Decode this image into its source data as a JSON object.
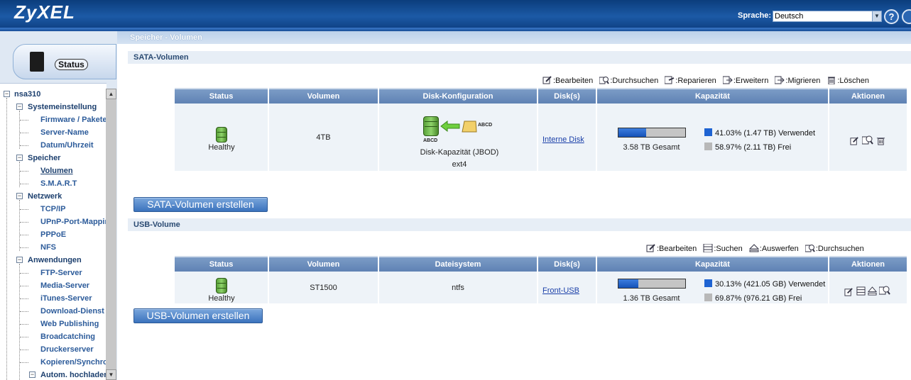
{
  "header": {
    "logo": "ZyXEL",
    "lang_label": "Sprache:",
    "lang_value": "Deutsch",
    "help_label": "?"
  },
  "sidebar": {
    "status_label": "Status",
    "tree": {
      "root": "nsa310",
      "systemeinstellung": "Systemeinstellung",
      "firmware": "Firmware / Pakete",
      "servername": "Server-Name",
      "datum": "Datum/Uhrzeit",
      "speicher": "Speicher",
      "volumen": "Volumen",
      "smart": "S.M.A.R.T",
      "netzwerk": "Netzwerk",
      "tcpip": "TCP/IP",
      "upnp": "UPnP-Port-Mapping",
      "pppoe": "PPPoE",
      "nfs": "NFS",
      "anwendungen": "Anwendungen",
      "ftp": "FTP-Server",
      "media": "Media-Server",
      "itunes": "iTunes-Server",
      "download": "Download-Dienst",
      "webpub": "Web Publishing",
      "broadcast": "Broadcatching",
      "drucker": "Druckerserver",
      "kopieren": "Kopieren/Synchronisieren",
      "autom": "Autom. hochladen"
    }
  },
  "main": {
    "breadcrumb": "Speicher - Volumen",
    "sata": {
      "title": "SATA-Volumen",
      "toolbar": {
        "edit": ":Bearbeiten",
        "search": ":Durchsuchen",
        "repair": ":Reparieren",
        "expand": ":Erweitern",
        "migrate": ":Migrieren",
        "delete": ":Löschen"
      },
      "columns": [
        "Status",
        "Volumen",
        "Disk-Konfiguration",
        "Disk(s)",
        "Kapazität",
        "Aktionen"
      ],
      "row": {
        "status": "Healthy",
        "volume": "4TB",
        "disk_label_a": "ABCD",
        "disk_label_b": "ABCD",
        "config": "Disk-Kapazität (JBOD)",
        "fs": "ext4",
        "disks": "Interne Disk",
        "total": "3.58 TB Gesamt",
        "used_pct": 41.03,
        "used": "41.03% (1.47 TB) Verwendet",
        "free": "58.97% (2.11 TB) Frei"
      },
      "create_button": "SATA-Volumen erstellen"
    },
    "usb": {
      "title": "USB-Volume",
      "toolbar": {
        "edit": ":Bearbeiten",
        "search": ":Suchen",
        "eject": ":Auswerfen",
        "browse": ":Durchsuchen"
      },
      "columns": [
        "Status",
        "Volumen",
        "Dateisystem",
        "Disk(s)",
        "Kapazität",
        "Aktionen"
      ],
      "row": {
        "status": "Healthy",
        "volume": "ST1500",
        "fs": "ntfs",
        "disks": "Front-USB",
        "total": "1.36 TB Gesamt",
        "used_pct": 30.13,
        "used": "30.13% (421.05 GB) Verwendet",
        "free": "69.87% (976.21 GB) Frei"
      },
      "create_button": "USB-Volumen erstellen"
    },
    "colors": {
      "used": "#1e63d2",
      "free": "#b8b8b8",
      "header_blue": "#6c8fbf"
    }
  }
}
